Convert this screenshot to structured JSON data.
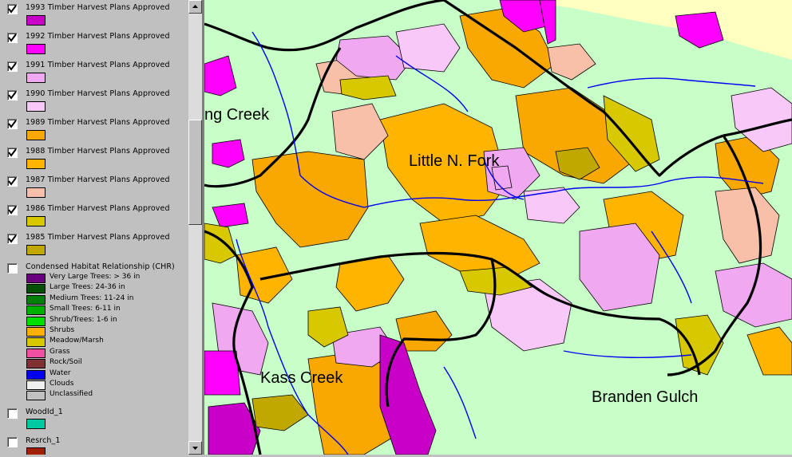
{
  "legend": {
    "thp_layers": [
      {
        "label": "1993 Timber Harvest Plans Approved",
        "checked": true,
        "color": "#c800c8"
      },
      {
        "label": "1992 Timber Harvest Plans Approved",
        "checked": true,
        "color": "#ff00ff"
      },
      {
        "label": "1991 Timber Harvest Plans Approved",
        "checked": true,
        "color": "#f0a8f0"
      },
      {
        "label": "1990 Timber Harvest Plans Approved",
        "checked": true,
        "color": "#f8c8f8"
      },
      {
        "label": "1989 Timber Harvest Plans Approved",
        "checked": true,
        "color": "#f8a800"
      },
      {
        "label": "1988 Timber Harvest Plans Approved",
        "checked": true,
        "color": "#ffb400"
      },
      {
        "label": "1987 Timber Harvest Plans Approved",
        "checked": true,
        "color": "#f8c0a8"
      },
      {
        "label": "1986 Timber Harvest Plans Approved",
        "checked": true,
        "color": "#d8c800"
      },
      {
        "label": "1985 Timber Harvest Plans Approved",
        "checked": true,
        "color": "#c0a800"
      }
    ],
    "chr_layer": {
      "label": "Condensed Habitat Relationship (CHR)",
      "checked": false,
      "items": [
        {
          "label": "Very Large Trees: > 36 in",
          "color": "#6a0080"
        },
        {
          "label": "Large Trees: 24-36 in",
          "color": "#005000"
        },
        {
          "label": "Medium Trees: 11-24 in",
          "color": "#008000"
        },
        {
          "label": "Small Trees: 6-11 in",
          "color": "#00b000"
        },
        {
          "label": "Shrub/Trees: 1-6 in",
          "color": "#00e000"
        },
        {
          "label": "Shrubs",
          "color": "#ffb000"
        },
        {
          "label": "Meadow/Marsh",
          "color": "#d8c800"
        },
        {
          "label": "Grass",
          "color": "#f050a0"
        },
        {
          "label": "Rock/Soil",
          "color": "#803030"
        },
        {
          "label": "Water",
          "color": "#0000f0"
        },
        {
          "label": "Clouds",
          "color": "#f0f0f0"
        },
        {
          "label": "Unclassified",
          "color": "#c0c0c0"
        }
      ]
    },
    "woodid_layer": {
      "label": "WoodId_1",
      "checked": false,
      "color": "#00c8a0"
    },
    "resrch_layer": {
      "label": "Resrch_1",
      "checked": false,
      "color": "#a02000"
    }
  },
  "map": {
    "labels": {
      "ng_creek": "ng Creek",
      "little_n_fork": "Little N. Fork",
      "kass_creek": "Kass Creek",
      "branden_gulch": "Branden Gulch"
    },
    "colors": {
      "background": "#c8ffc8",
      "ocean": "#ffffc0",
      "stream": "#0000f0",
      "boundary": "#000000"
    }
  }
}
